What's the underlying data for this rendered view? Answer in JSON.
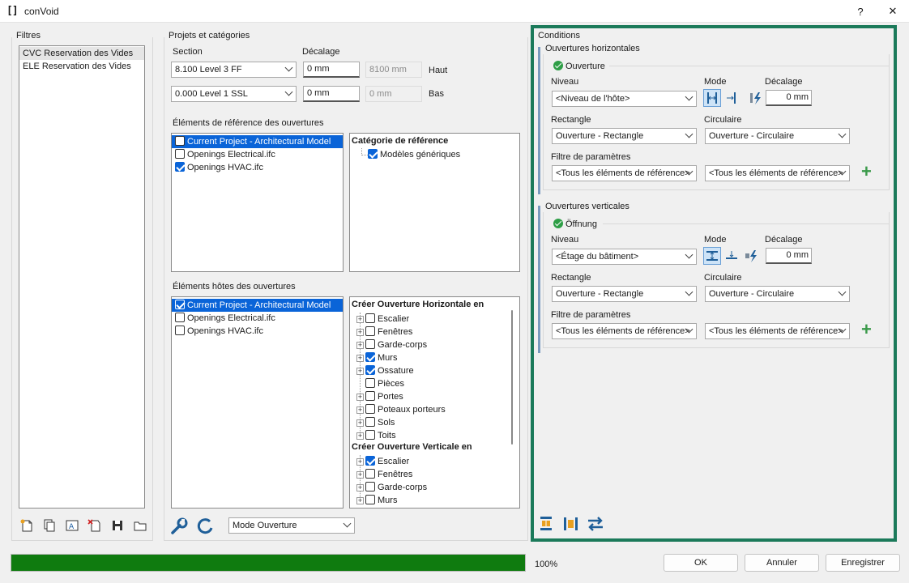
{
  "window": {
    "title": "conVoid",
    "help_label": "?",
    "close_label": "✕"
  },
  "filters": {
    "label": "Filtres",
    "items": [
      "CVC Reservation des Vides",
      "ELE Reservation des Vides"
    ]
  },
  "projects": {
    "label": "Projets et catégories",
    "section_label": "Section",
    "offset_label": "Décalage",
    "top": {
      "section": "8.100  Level 3 FF",
      "offset": "0 mm",
      "computed": "8100 mm",
      "side": "Haut"
    },
    "bottom": {
      "section": "0.000  Level 1 SSL",
      "offset": "0 mm",
      "computed": "0 mm",
      "side": "Bas"
    }
  },
  "reference": {
    "label": "Éléments de référence des ouvertures",
    "items": [
      {
        "label": "Current Project - Architectural Model",
        "checked": false,
        "selected": true
      },
      {
        "label": "Openings Electrical.ifc",
        "checked": false,
        "selected": false
      },
      {
        "label": "Openings HVAC.ifc",
        "checked": true,
        "selected": false
      }
    ],
    "category_header": "Catégorie de référence",
    "category_item": "Modèles génériques"
  },
  "hosts": {
    "label": "Éléments hôtes des ouvertures",
    "items": [
      {
        "label": "Current Project - Architectural Model",
        "checked": true,
        "selected": true
      },
      {
        "label": "Openings Electrical.ifc",
        "checked": false,
        "selected": false
      },
      {
        "label": "Openings HVAC.ifc",
        "checked": false,
        "selected": false
      }
    ],
    "horizontal_header": "Créer Ouverture Horizontale en",
    "horizontal_items": [
      {
        "label": "Escalier",
        "checked": false,
        "expand": true
      },
      {
        "label": "Fenêtres",
        "checked": false,
        "expand": true
      },
      {
        "label": "Garde-corps",
        "checked": false,
        "expand": true
      },
      {
        "label": "Murs",
        "checked": true,
        "expand": true
      },
      {
        "label": "Ossature",
        "checked": true,
        "expand": true
      },
      {
        "label": "Pièces",
        "checked": false,
        "expand": false
      },
      {
        "label": "Portes",
        "checked": false,
        "expand": true
      },
      {
        "label": "Poteaux porteurs",
        "checked": false,
        "expand": true
      },
      {
        "label": "Sols",
        "checked": false,
        "expand": true
      },
      {
        "label": "Toits",
        "checked": false,
        "expand": true
      }
    ],
    "vertical_header": "Créer Ouverture Verticale en",
    "vertical_items": [
      {
        "label": "Escalier",
        "checked": true,
        "expand": true
      },
      {
        "label": "Fenêtres",
        "checked": false,
        "expand": true
      },
      {
        "label": "Garde-corps",
        "checked": false,
        "expand": true
      },
      {
        "label": "Murs",
        "checked": false,
        "expand": true
      }
    ]
  },
  "mode_select": "Mode Ouverture",
  "conditions": {
    "label": "Conditions",
    "horizontal": {
      "label": "Ouvertures horizontales",
      "status": "Ouverture",
      "level_label": "Niveau",
      "level_value": "<Niveau de l'hôte>",
      "mode_label": "Mode",
      "offset_label": "Décalage",
      "offset_value": "0 mm",
      "rect_label": "Rectangle",
      "rect_value": "Ouverture - Rectangle",
      "circ_label": "Circulaire",
      "circ_value": "Ouverture - Circulaire",
      "filter_label": "Filtre de paramètres",
      "filter_a": "<Tous les éléments de référence>",
      "filter_b": "<Tous les éléments de référence>"
    },
    "vertical": {
      "label": "Ouvertures verticales",
      "status": "Öffnung",
      "level_label": "Niveau",
      "level_value": "<Étage du bâtiment>",
      "mode_label": "Mode",
      "offset_label": "Décalage",
      "offset_value": "0 mm",
      "rect_label": "Rectangle",
      "rect_value": "Ouverture - Rectangle",
      "circ_label": "Circulaire",
      "circ_value": "Ouverture - Circulaire",
      "filter_label": "Filtre de paramètres",
      "filter_a": "<Tous les éléments de référence>",
      "filter_b": "<Tous les éléments de référence>"
    }
  },
  "progress": {
    "value": 1.0,
    "text": "100%"
  },
  "buttons": {
    "ok": "OK",
    "cancel": "Annuler",
    "save": "Enregistrer"
  },
  "colors": {
    "accent": "#0a64d8",
    "progress": "#0f7b0f",
    "frame": "#1b7a5a"
  }
}
